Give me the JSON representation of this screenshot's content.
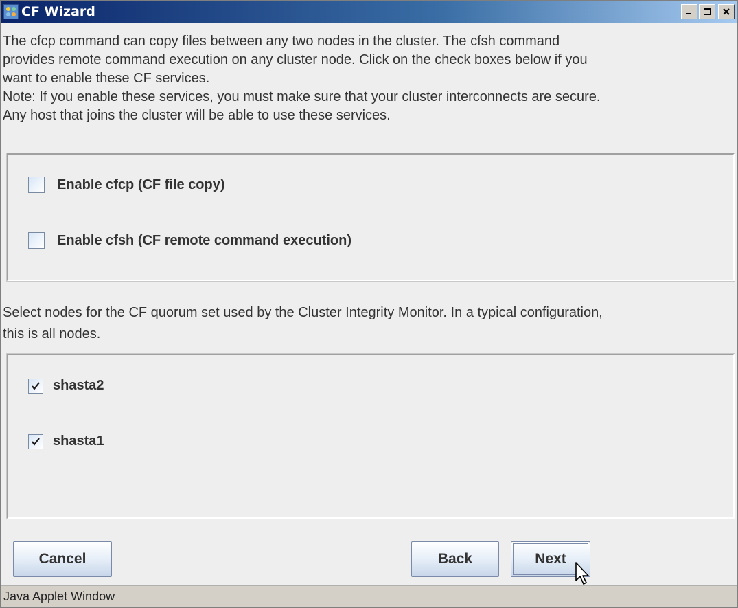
{
  "window": {
    "title": "CF Wizard",
    "status_bar": "Java Applet Window"
  },
  "intro": {
    "line1": "The cfcp command can copy files between any two nodes in the cluster.  The cfsh command",
    "line2": "provides remote command execution on any cluster node.  Click on the check boxes below if you",
    "line3": "want to enable these CF services.",
    "line4": "Note: If you enable these services, you must make sure that your cluster interconnects are secure.",
    "line5": "Any host that joins the cluster will be able to use these services."
  },
  "services": [
    {
      "label": "Enable cfcp (CF file copy)",
      "checked": false
    },
    {
      "label": "Enable cfsh (CF remote command execution)",
      "checked": false
    }
  ],
  "quorum": {
    "line1": "Select nodes for the CF quorum set used by the Cluster Integrity Monitor.  In a typical configuration,",
    "line2": "this is all nodes."
  },
  "nodes": [
    {
      "label": "shasta2",
      "checked": true
    },
    {
      "label": "shasta1",
      "checked": true
    }
  ],
  "buttons": {
    "cancel": "Cancel",
    "back": "Back",
    "next": "Next"
  }
}
